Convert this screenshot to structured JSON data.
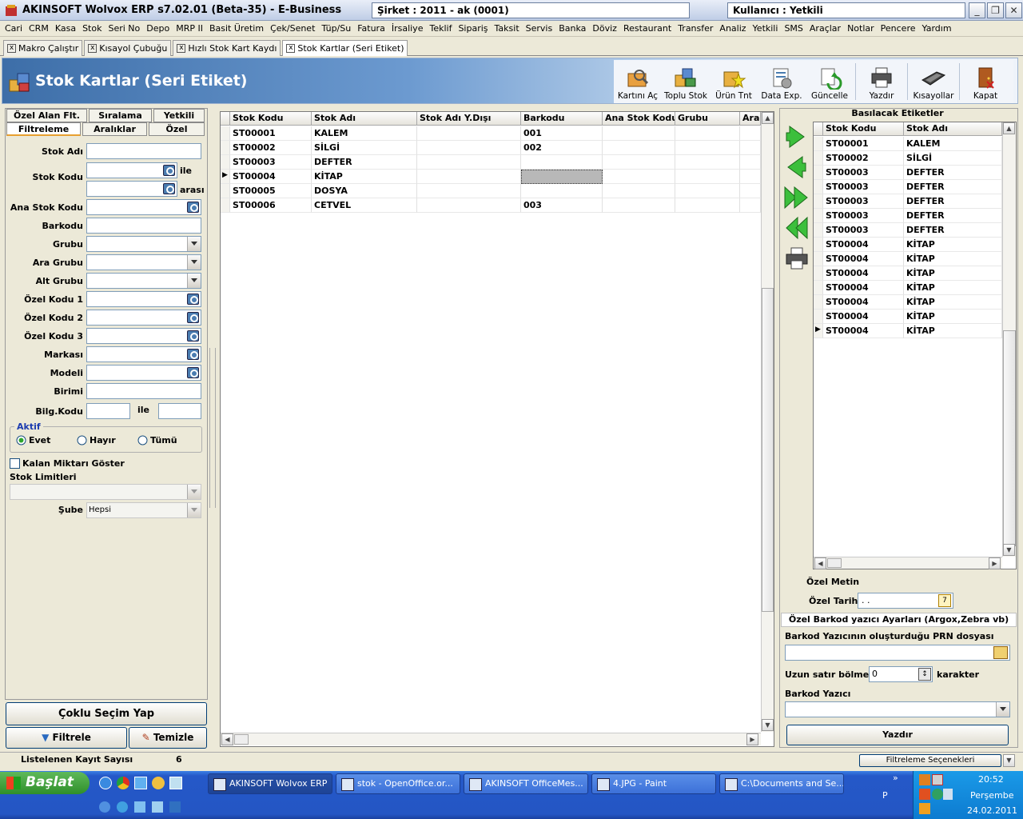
{
  "window": {
    "title": "AKINSOFT Wolvox ERP s7.02.01 (Beta-35) - E-Business",
    "company": "Şirket : 2011 - ak (0001)",
    "user": "Kullanıcı : Yetkili"
  },
  "menu": [
    "Cari",
    "CRM",
    "Kasa",
    "Stok",
    "Seri No",
    "Depo",
    "MRP II",
    "Basit Üretim",
    "Çek/Senet",
    "Tüp/Su",
    "Fatura",
    "İrsaliye",
    "Teklif",
    "Sipariş",
    "Taksit",
    "Servis",
    "Banka",
    "Döviz",
    "Restaurant",
    "Transfer",
    "Analiz",
    "Yetkili",
    "SMS",
    "Araçlar",
    "Notlar",
    "Pencere",
    "Yardım"
  ],
  "doc_tabs": [
    "Makro Çalıştır",
    "Kısayol Çubuğu",
    "Hızlı Stok Kart Kaydı",
    "Stok Kartlar (Seri Etiket)"
  ],
  "header": {
    "title": "Stok Kartlar (Seri Etiket)"
  },
  "toolbar": [
    "Kartını Aç",
    "Toplu Stok",
    "Ürün Tnt",
    "Data Exp.",
    "Güncelle",
    "Yazdır",
    "Kısayollar",
    "Kapat"
  ],
  "left": {
    "tabs_top": [
      "Özel Alan Flt.",
      "Sıralama",
      "Yetkili"
    ],
    "tabs_bottom": [
      "Filtreleme",
      "Aralıklar",
      "Özel"
    ],
    "labels": {
      "stok_adi": "Stok Adı",
      "stok_kodu": "Stok Kodu",
      "ile": "ile",
      "arasi": "arası",
      "ana_stok_kodu": "Ana Stok Kodu",
      "barkodu": "Barkodu",
      "grubu": "Grubu",
      "ara_grubu": "Ara Grubu",
      "alt_grubu": "Alt Grubu",
      "ozel_kodu_1": "Özel Kodu 1",
      "ozel_kodu_2": "Özel Kodu 2",
      "ozel_kodu_3": "Özel Kodu 3",
      "markasi": "Markası",
      "modeli": "Modeli",
      "birimi": "Birimi",
      "bilg_kodu": "Bilg.Kodu",
      "bilg_ile": "ile"
    },
    "aktif": {
      "title": "Aktif",
      "options": [
        "Evet",
        "Hayır",
        "Tümü"
      ],
      "selected": "Evet"
    },
    "kalan_miktari": "Kalan Miktarı Göster",
    "stok_limitleri": "Stok Limitleri",
    "sube_label": "Şube",
    "sube_value": "Hepsi",
    "coklu_secim": "Çoklu Seçim Yap",
    "filtrele": "Filtrele",
    "temizle": "Temizle"
  },
  "grid": {
    "columns": [
      "Stok Kodu",
      "Stok Adı",
      "Stok Adı Y.Dışı",
      "Barkodu",
      "Ana Stok Kodu",
      "Grubu",
      "Ara"
    ],
    "rows": [
      [
        "ST00001",
        "KALEM",
        "",
        "001",
        "",
        "",
        ""
      ],
      [
        "ST00002",
        "SİLGİ",
        "",
        "002",
        "",
        "",
        ""
      ],
      [
        "ST00003",
        "DEFTER",
        "",
        "",
        "",
        "",
        ""
      ],
      [
        "ST00004",
        "KİTAP",
        "",
        "",
        "",
        "",
        ""
      ],
      [
        "ST00005",
        "DOSYA",
        "",
        "",
        "",
        "",
        ""
      ],
      [
        "ST00006",
        "CETVEL",
        "",
        "003",
        "",
        "",
        ""
      ]
    ],
    "current_row": 3
  },
  "right": {
    "title": "Basılacak Etiketler",
    "columns": [
      "Stok Kodu",
      "Stok Adı"
    ],
    "rows": [
      [
        "ST00001",
        "KALEM"
      ],
      [
        "ST00002",
        "SİLGİ"
      ],
      [
        "ST00003",
        "DEFTER"
      ],
      [
        "ST00003",
        "DEFTER"
      ],
      [
        "ST00003",
        "DEFTER"
      ],
      [
        "ST00003",
        "DEFTER"
      ],
      [
        "ST00003",
        "DEFTER"
      ],
      [
        "ST00004",
        "KİTAP"
      ],
      [
        "ST00004",
        "KİTAP"
      ],
      [
        "ST00004",
        "KİTAP"
      ],
      [
        "ST00004",
        "KİTAP"
      ],
      [
        "ST00004",
        "KİTAP"
      ],
      [
        "ST00004",
        "KİTAP"
      ],
      [
        "ST00004",
        "KİTAP"
      ]
    ],
    "current_row": 13,
    "ozel_metin": "Özel Metin",
    "ozel_tarih": "Özel Tarih",
    "ozel_tarih_value": " . .",
    "barkod_section": "Özel Barkod yazıcı Ayarları (Argox,Zebra vb)",
    "prn_label": "Barkod Yazıcının oluşturduğu PRN dosyası",
    "uzun_satir": "Uzun satır bölme",
    "uzun_value": "0",
    "karakter": "karakter",
    "barkod_yazici": "Barkod Yazıcı",
    "yazdir": "Yazdır"
  },
  "status": {
    "label": "Listelenen Kayıt Sayısı",
    "count": "6",
    "filter_options": "Filtreleme Seçenekleri"
  },
  "taskbar": {
    "start": "Başlat",
    "tasks": [
      "AKINSOFT Wolvox ERP",
      "stok - OpenOffice.or...",
      "AKINSOFT OfficeMes...",
      "4.JPG - Paint",
      "C:\\Documents and Se..."
    ],
    "lang": "P",
    "time": "20:52",
    "day": "Perşembe",
    "date": "24.02.2011"
  }
}
